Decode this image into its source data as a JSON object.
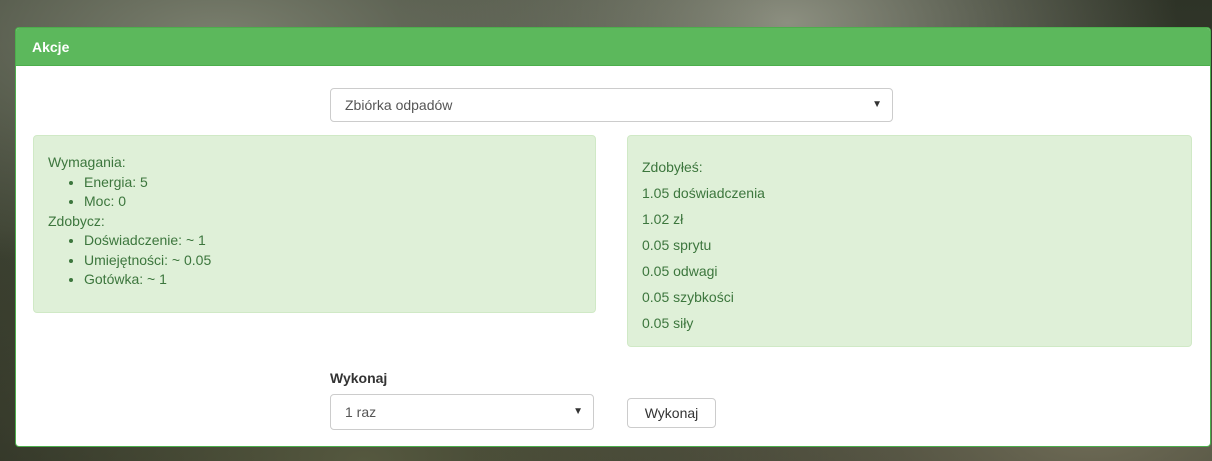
{
  "panel": {
    "title": "Akcje"
  },
  "action_select": {
    "selected": "Zbiórka odpadów",
    "caret": "▼"
  },
  "requirements": {
    "heading": "Wymagania:",
    "items": [
      "Energia: 5",
      "Moc: 0"
    ],
    "loot_heading": "Zdobycz:",
    "loot_items": [
      "Doświadczenie: ~ 1",
      "Umiejętności: ~ 0.05",
      "Gotówka: ~ 1"
    ]
  },
  "gains": {
    "heading": "Zdobyłeś:",
    "lines": [
      "1.05 doświadczenia",
      "1.02 zł",
      "0.05 sprytu",
      "0.05 odwagi",
      "0.05 szybkości",
      "0.05 siły"
    ]
  },
  "execute": {
    "label": "Wykonaj",
    "count_selected": "1 raz",
    "caret": "▼",
    "button_label": "Wykonaj"
  },
  "colors": {
    "header_green": "#5cb85c",
    "well_green": "#dff0d8",
    "well_text": "#3c763d"
  }
}
